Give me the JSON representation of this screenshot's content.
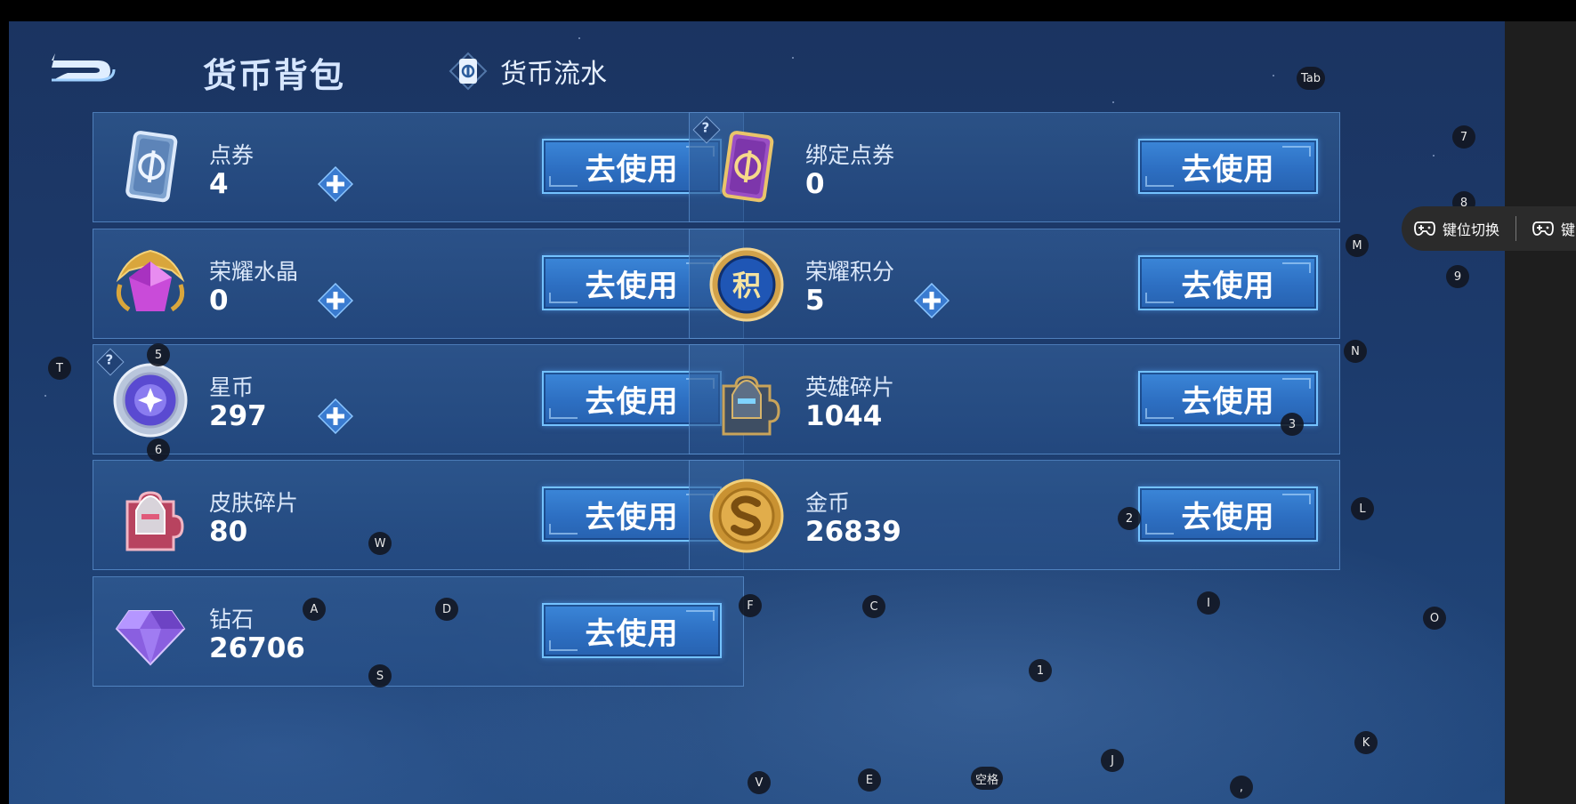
{
  "header": {
    "title": "货币背包",
    "flow_tab_label": "货币流水"
  },
  "action_label": "去使用",
  "currencies": [
    {
      "name": "点券",
      "value": "4",
      "icon": "voucher-icon",
      "has_plus": true,
      "has_help": false
    },
    {
      "name": "绑定点券",
      "value": "0",
      "icon": "bound-voucher-icon",
      "has_plus": false,
      "has_help": true
    },
    {
      "name": "荣耀水晶",
      "value": "0",
      "icon": "glory-crystal-icon",
      "has_plus": true,
      "has_help": false
    },
    {
      "name": "荣耀积分",
      "value": "5",
      "icon": "glory-points-icon",
      "has_plus": true,
      "has_help": false
    },
    {
      "name": "星币",
      "value": "297",
      "icon": "star-coin-icon",
      "has_plus": true,
      "has_help": true
    },
    {
      "name": "英雄碎片",
      "value": "1044",
      "icon": "hero-fragment-icon",
      "has_plus": false,
      "has_help": false
    },
    {
      "name": "皮肤碎片",
      "value": "80",
      "icon": "skin-fragment-icon",
      "has_plus": false,
      "has_help": false
    },
    {
      "name": "金币",
      "value": "26839",
      "icon": "gold-coin-icon",
      "has_plus": false,
      "has_help": false
    },
    {
      "name": "钻石",
      "value": "26706",
      "icon": "diamond-icon",
      "has_plus": false,
      "has_help": false
    }
  ],
  "icon_text": {
    "glory_points": "积",
    "help": "?"
  },
  "keymap": {
    "tab": "Tab",
    "k7": "7",
    "k8": "8",
    "m": "M",
    "k9": "9",
    "n": "N",
    "t": "T",
    "k5": "5",
    "k6": "6",
    "k3": "3",
    "k2": "2",
    "l": "L",
    "w": "W",
    "a": "A",
    "d": "D",
    "f": "F",
    "c": "C",
    "i": "I",
    "o": "O",
    "k1": "1",
    "s": "S",
    "k": "K",
    "j": "J",
    "v": "V",
    "e": "E",
    "space": "空格",
    "comma": ","
  },
  "overlay": {
    "switch_label": "键位切换",
    "second_label": "键"
  },
  "colors": {
    "background": "#1c3a6b",
    "button": "#2d6fc2",
    "button_border": "#74c2ff",
    "card_border": "#6ea5e6"
  }
}
